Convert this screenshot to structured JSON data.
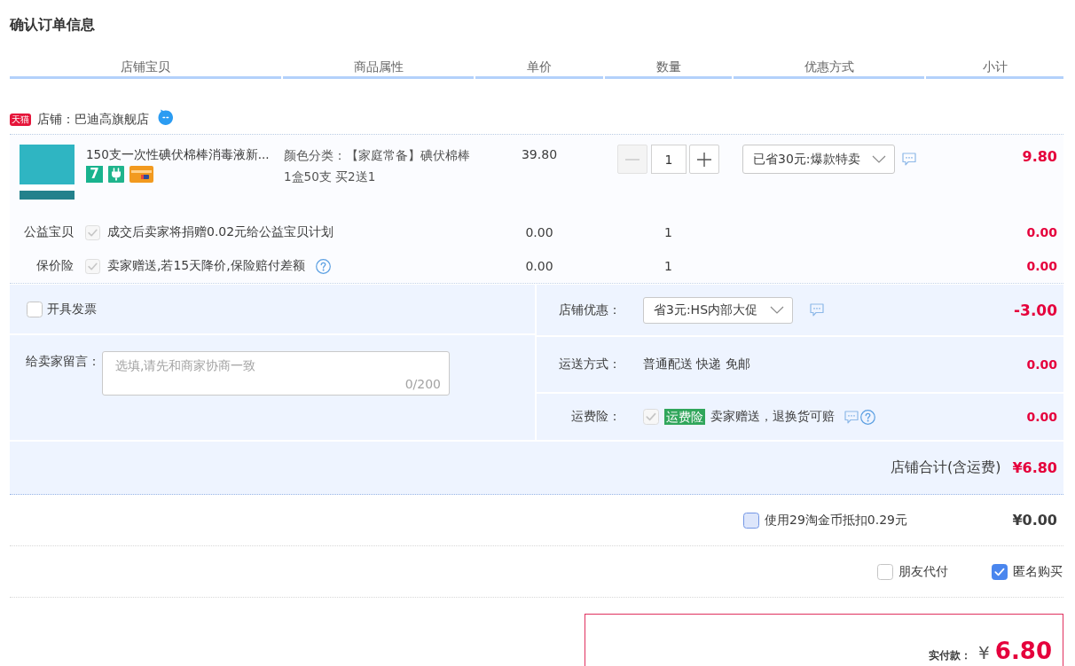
{
  "page_title": "确认订单信息",
  "table": {
    "columns": [
      "店铺宝贝",
      "商品属性",
      "单价",
      "数量",
      "优惠方式",
      "小计"
    ]
  },
  "store": {
    "badge": "天猫",
    "name": "店铺：巴迪高旗舰店"
  },
  "items": [
    {
      "title": "150支一次性碘伏棉棒消毒液新...",
      "badges": [
        {
          "kind": "number",
          "label": "7"
        },
        {
          "kind": "plug"
        },
        {
          "kind": "card"
        }
      ],
      "attributes": [
        "颜色分类：【家庭常备】碘伏棉棒",
        "1盒50支 买2送1"
      ],
      "price": "39.80",
      "quantity": {
        "value": "1",
        "decrease_disabled": true
      },
      "promotion": "已省30元:爆款特卖",
      "subtotal": "9.80"
    }
  ],
  "services": [
    {
      "label": "公益宝贝",
      "checked": true,
      "disabled": true,
      "description": "成交后卖家将捐赠0.02元给公益宝贝计划",
      "help": false,
      "price": "0.00",
      "quantity": "1",
      "subtotal": "0.00"
    },
    {
      "label": "保价险",
      "checked": true,
      "disabled": true,
      "description": "卖家赠送,若15天降价,保险赔付差额",
      "help": true,
      "price": "0.00",
      "quantity": "1",
      "subtotal": "0.00"
    }
  ],
  "invoice": {
    "label": "开具发票",
    "checked": false
  },
  "message": {
    "label": "给卖家留言：",
    "placeholder": "选填,请先和商家协商一致",
    "counter": "0/200"
  },
  "fees": [
    {
      "kind": "select",
      "label": "店铺优惠：",
      "value": "省3元:HS内部大促",
      "amount": "-3.00"
    },
    {
      "kind": "text",
      "label": "运送方式：",
      "value": "普通配送 快递 免邮",
      "amount": "0.00"
    },
    {
      "kind": "insurance",
      "label": "运费险：",
      "checked": true,
      "disabled": true,
      "tag": "运费险",
      "value": "卖家赠送，退换货可赔",
      "amount": "0.00"
    }
  ],
  "store_total": {
    "label": "店铺合计(含运费)",
    "amount": "¥6.80"
  },
  "coins": {
    "label": "使用29淘金币抵扣0.29元",
    "checked": false,
    "amount": "¥0.00"
  },
  "pay_options": [
    {
      "label": "朋友代付",
      "checked": false
    },
    {
      "label": "匿名购买",
      "checked": true
    }
  ],
  "payment": {
    "label": "实付款：",
    "currency": "¥",
    "amount": "6.80"
  }
}
